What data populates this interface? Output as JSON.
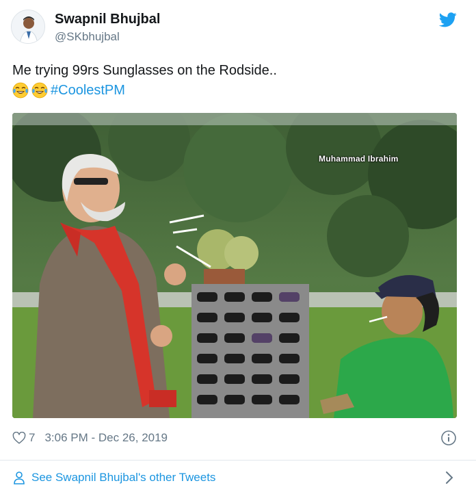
{
  "author": {
    "name": "Swapnil Bhujbal",
    "handle": "@SKbhujbal"
  },
  "tweet": {
    "text": "Me trying 99rs Sunglasses on the Rodside..",
    "emojis": [
      "face-with-tears-of-joy",
      "face-with-tears-of-joy"
    ],
    "hashtag": "#CoolestPM"
  },
  "media": {
    "watermark": "Muhammad Ibrahim"
  },
  "footer": {
    "likes": "7",
    "timestamp": "3:06 PM - Dec 26, 2019",
    "see_more": "See Swapnil Bhujbal's other Tweets"
  },
  "colors": {
    "brand": "#1da1f2",
    "link": "#1b95e0",
    "muted": "#657786"
  }
}
